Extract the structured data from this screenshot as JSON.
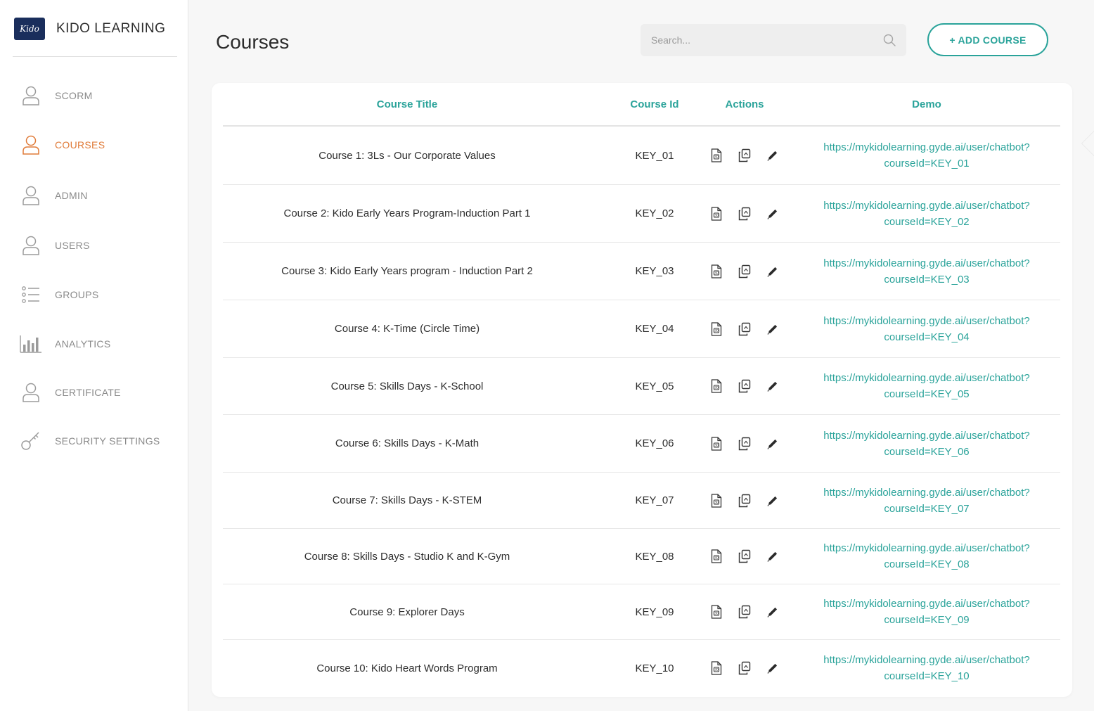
{
  "brand": {
    "logo_text": "Kido",
    "name": "KIDO LEARNING"
  },
  "sidebar": {
    "items": [
      {
        "label": "SCORM",
        "icon": "user-icon",
        "active": false
      },
      {
        "label": "COURSES",
        "icon": "user-icon",
        "active": true
      },
      {
        "label": "ADMIN",
        "icon": "user-icon",
        "active": false
      },
      {
        "label": "USERS",
        "icon": "user-icon",
        "active": false
      },
      {
        "label": "GROUPS",
        "icon": "list-icon",
        "active": false
      },
      {
        "label": "ANALYTICS",
        "icon": "bar-chart-icon",
        "active": false
      },
      {
        "label": "CERTIFICATE",
        "icon": "user-icon",
        "active": false
      },
      {
        "label": "SECURITY SETTINGS",
        "icon": "key-icon",
        "active": false
      }
    ]
  },
  "header": {
    "title": "Courses",
    "search_placeholder": "Search...",
    "add_button": "+ ADD COURSE"
  },
  "table": {
    "columns": [
      "Course Title",
      "Course Id",
      "Actions",
      "Demo"
    ],
    "actions_icons": [
      "document-icon",
      "copy-icon",
      "edit-pencil-icon"
    ],
    "rows": [
      {
        "title": "Course 1: 3Ls - Our Corporate Values",
        "id": "KEY_01",
        "demo": "https://mykidolearning.gyde.ai/user/chatbot?courseId=KEY_01"
      },
      {
        "title": "Course 2: Kido Early Years Program-Induction Part 1",
        "id": "KEY_02",
        "demo": "https://mykidolearning.gyde.ai/user/chatbot?courseId=KEY_02"
      },
      {
        "title": "Course 3: Kido Early Years program - Induction Part 2",
        "id": "KEY_03",
        "demo": "https://mykidolearning.gyde.ai/user/chatbot?courseId=KEY_03"
      },
      {
        "title": "Course 4: K-Time (Circle Time)",
        "id": "KEY_04",
        "demo": "https://mykidolearning.gyde.ai/user/chatbot?courseId=KEY_04"
      },
      {
        "title": "Course 5: Skills Days - K-School",
        "id": "KEY_05",
        "demo": "https://mykidolearning.gyde.ai/user/chatbot?courseId=KEY_05"
      },
      {
        "title": "Course 6: Skills Days - K-Math",
        "id": "KEY_06",
        "demo": "https://mykidolearning.gyde.ai/user/chatbot?courseId=KEY_06"
      },
      {
        "title": "Course 7: Skills Days - K-STEM",
        "id": "KEY_07",
        "demo": "https://mykidolearning.gyde.ai/user/chatbot?courseId=KEY_07"
      },
      {
        "title": "Course 8: Skills Days - Studio K and K-Gym",
        "id": "KEY_08",
        "demo": "https://mykidolearning.gyde.ai/user/chatbot?courseId=KEY_08"
      },
      {
        "title": "Course 9: Explorer Days",
        "id": "KEY_09",
        "demo": "https://mykidolearning.gyde.ai/user/chatbot?courseId=KEY_09"
      },
      {
        "title": "Course 10: Kido Heart Words Program",
        "id": "KEY_10",
        "demo": "https://mykidolearning.gyde.ai/user/chatbot?courseId=KEY_10"
      }
    ]
  },
  "colors": {
    "accent": "#2aa39a",
    "active": "#e07b39",
    "brand_navy": "#1a2e5c"
  }
}
